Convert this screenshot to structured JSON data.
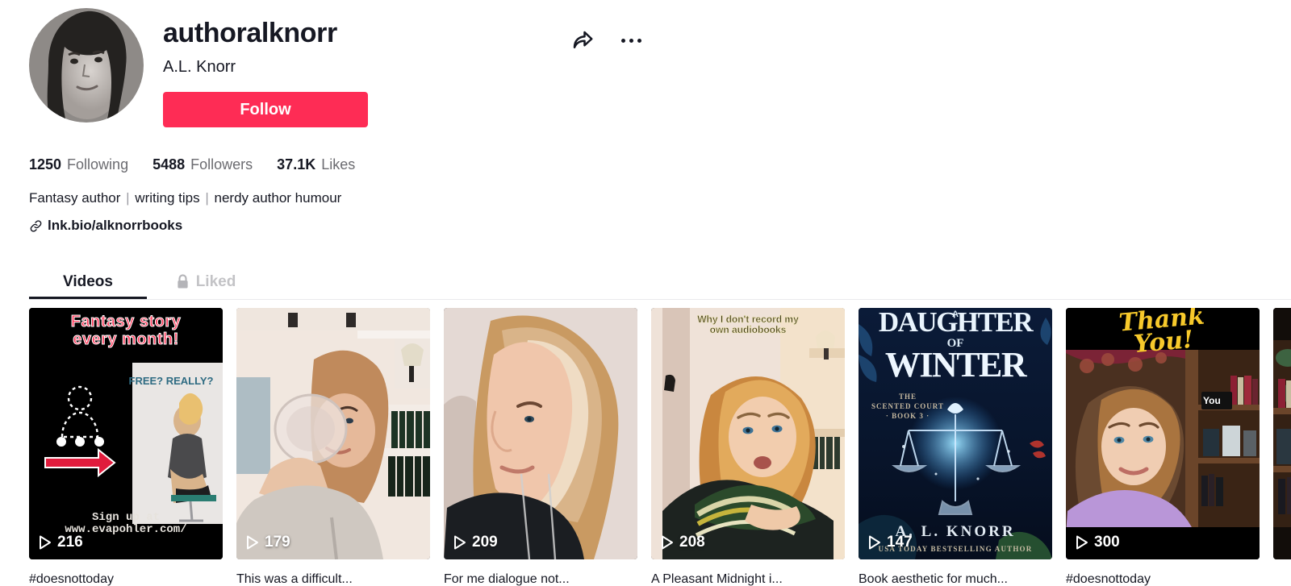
{
  "profile": {
    "username": "authoralknorr",
    "nickname": "A.L. Knorr",
    "follow_label": "Follow",
    "share_icon": "share-arrow-icon",
    "more_icon": "more-options-icon",
    "avatar_alt": "authoralknorr profile photo",
    "stats": [
      {
        "num": "1250",
        "label": "Following"
      },
      {
        "num": "5488",
        "label": "Followers"
      },
      {
        "num": "37.1K",
        "label": "Likes"
      }
    ],
    "bio_parts": [
      "Fantasy author",
      "writing tips",
      "nerdy author humour"
    ],
    "bio_separator": "|",
    "bio_link": "lnk.bio/alknorrbooks",
    "link_icon": "link-chain-icon"
  },
  "tabs": [
    {
      "label": "Videos",
      "active": true,
      "icon": ""
    },
    {
      "label": "Liked",
      "active": false,
      "icon": "lock-icon"
    }
  ],
  "colors": {
    "accent": "#fe2c55",
    "text": "#161823",
    "muted": "#6b6b70",
    "tab_inactive": "#c3c3c6",
    "divider": "#eaeaec"
  },
  "videos": [
    {
      "views": "216",
      "play_icon": "play-icon",
      "caption": "#doesnottoday",
      "overlay_title": "Fantasy story\never month!",
      "overlay_lines": [
        "Fantasy story",
        "every month!"
      ],
      "inner_text": "FREE? REALLY?",
      "footer_lines": [
        "Sign up at",
        "www.evapohler.com/"
      ],
      "style": "fantasy-promo"
    },
    {
      "views": "179",
      "play_icon": "play-icon",
      "caption": "This was a difficult...",
      "overlay_lines": [],
      "style": "drinking-water"
    },
    {
      "views": "209",
      "play_icon": "play-icon",
      "caption": "For me dialogue not...",
      "overlay_lines": [],
      "style": "side-profile"
    },
    {
      "views": "208",
      "play_icon": "play-icon",
      "caption": "A Pleasant Midnight i...",
      "overlay_lines": [
        "Why I don't record my",
        "own audiobooks"
      ],
      "style": "audiobooks"
    },
    {
      "views": "147",
      "play_icon": "play-icon",
      "caption": "Book aesthetic for much...",
      "overlay_lines": [],
      "book": {
        "article": "A",
        "title_top": "DAUGHTER",
        "title_of": "OF",
        "title_bottom": "WINTER",
        "series": "THE\nSCENTED COURT\n· BOOK 3 ·",
        "series_lines": [
          "THE",
          "SCENTED COURT",
          "· BOOK 3 ·"
        ],
        "author": "A. L.  KNORR",
        "tagline": "USA TODAY BESTSELLING AUTHOR"
      },
      "style": "book-cover"
    },
    {
      "views": "300",
      "play_icon": "play-icon",
      "caption": "#doesnottoday",
      "overlay_lines": [
        "Thank",
        "You!"
      ],
      "shelf_label": "You",
      "style": "thank-you"
    },
    {
      "views": "",
      "play_icon": "play-icon",
      "caption": "",
      "overlay_lines": [],
      "style": "bookshelf-partial"
    }
  ]
}
